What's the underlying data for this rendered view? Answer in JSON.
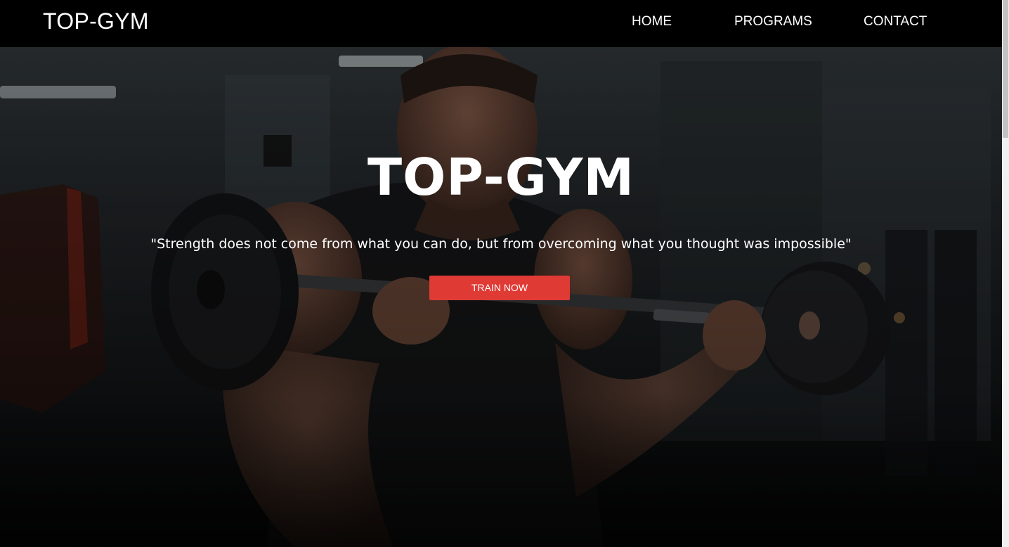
{
  "navbar": {
    "brand": "TOP-GYM",
    "links": [
      "HOME",
      "PROGRAMS",
      "CONTACT"
    ]
  },
  "hero": {
    "title": "TOP-GYM",
    "quote": "\"Strength does not come from what you can do, but from overcoming what you thought was impossible\"",
    "cta_label": "TRAIN NOW",
    "background_image": "man-lifting-barbell-in-gym-photo"
  },
  "colors": {
    "navbar_bg": "#000000",
    "cta_bg": "#e03a35",
    "text": "#ffffff"
  }
}
